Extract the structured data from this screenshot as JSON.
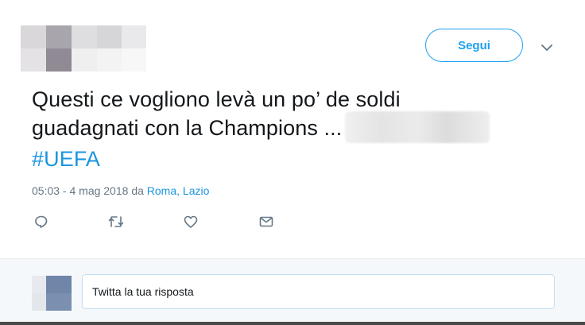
{
  "header": {
    "follow_label": "Segui",
    "more_icon": "chevron-down-icon"
  },
  "tweet": {
    "text_line1": "Questi ce vogliono levà un po’ de soldi",
    "text_line2": "guadagnati con la Champions ...",
    "hashtag": "#UEFA",
    "timestamp": "05:03 - 4 mag 2018",
    "location_prefix": "da",
    "location": "Roma, Lazio"
  },
  "actions": [
    {
      "icon": "reply-icon"
    },
    {
      "icon": "retweet-icon"
    },
    {
      "icon": "like-heart-icon"
    },
    {
      "icon": "direct-message-icon"
    }
  ],
  "reply": {
    "placeholder": "Twitta la tua risposta"
  },
  "colors": {
    "accent": "#1da1f2",
    "link": "#1b95e0",
    "text": "#14171a",
    "muted": "#657786",
    "reply_bg": "#f5f8fa"
  }
}
